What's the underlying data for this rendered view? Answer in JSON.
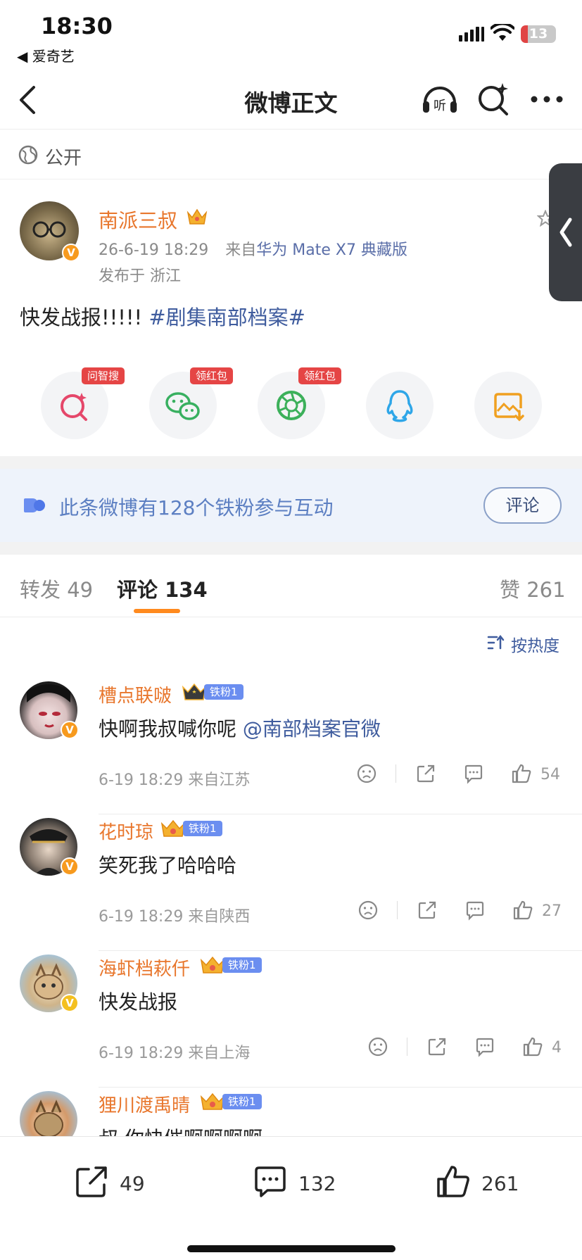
{
  "status_bar": {
    "time": "18:30",
    "back_app": "◀ 爱奇艺",
    "battery": "13"
  },
  "nav": {
    "title": "微博正文",
    "listen_icon": "listen-icon",
    "search_icon": "smart-search-icon",
    "more_icon": "more-icon"
  },
  "visibility": {
    "label": "公开"
  },
  "post": {
    "author": "南派三叔",
    "time": "26-6-19 18:29",
    "source_prefix": "来自",
    "device": "华为 Mate X7 典藏版",
    "location": "发布于 浙江",
    "text": "快发战报!!!!! ",
    "hashtag": "#剧集南部档案#"
  },
  "share": {
    "items": [
      {
        "icon": "ai-search-icon",
        "badge": "问智搜"
      },
      {
        "icon": "wechat-icon",
        "badge": "领红包"
      },
      {
        "icon": "moments-icon",
        "badge": "领红包"
      },
      {
        "icon": "qq-icon",
        "badge": ""
      },
      {
        "icon": "save-image-icon",
        "badge": ""
      }
    ]
  },
  "fans_banner": {
    "text": "此条微博有128个铁粉参与互动",
    "button": "评论"
  },
  "tabs": {
    "repost": "转发 49",
    "comment": "评论 134",
    "like": "赞 261"
  },
  "sort": {
    "label": "按热度"
  },
  "comments": [
    {
      "name": "槽点联啵",
      "fan_badge": "铁粉1",
      "text": "快啊我叔喊你呢 ",
      "mention": "@南部档案官微",
      "meta": "6-19 18:29 来自江苏",
      "likes": "54"
    },
    {
      "name": "花时琼",
      "fan_badge": "铁粉1",
      "text": "笑死我了哈哈哈",
      "mention": "",
      "meta": "6-19 18:29 来自陕西",
      "likes": "27"
    },
    {
      "name": "海虾档萩仟",
      "fan_badge": "铁粉1",
      "text": "快发战报",
      "mention": "",
      "meta": "6-19 18:29 来自上海",
      "likes": "4"
    },
    {
      "name": "狸川渡禹晴",
      "fan_badge": "铁粉1",
      "text": "叔 你快催啊啊啊啊",
      "mention": "",
      "meta": "",
      "likes": ""
    }
  ],
  "bottom_bar": {
    "reposts": "49",
    "comments": "132",
    "likes": "261"
  },
  "colors": {
    "accent_orange": "#e8762c",
    "link_blue": "#3f5c9e",
    "fan_badge_blue": "#6b8ef0",
    "badge_red": "#e54545"
  }
}
